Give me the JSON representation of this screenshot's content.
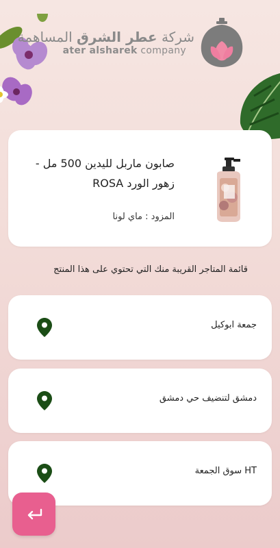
{
  "header": {
    "brand_ar_prefix": "شركة",
    "brand_ar_bold": "عطر الشرق",
    "brand_ar_suffix": "المساهمة",
    "brand_en_bold": "ater alsharek",
    "brand_en_rest": "company"
  },
  "product": {
    "title": "صابون ماربل لليدين  500 مل - زهور الورد ROSA",
    "supplier": "المزود : ماي لونا",
    "image_icon": "soap-bottle-icon"
  },
  "stores_section": {
    "title": "قائمة المتاجر القريبة منك التي تحتوي على هذا المنتج"
  },
  "stores": [
    {
      "name": "جمعة ابوكيل"
    },
    {
      "name": "دمشق لتنضيف حي دمشق"
    },
    {
      "name": "HT سوق الجمعة"
    }
  ],
  "colors": {
    "accent": "#e85f8f",
    "pin": "#1b4d16"
  },
  "back_button": {
    "icon": "return-arrow-icon"
  }
}
